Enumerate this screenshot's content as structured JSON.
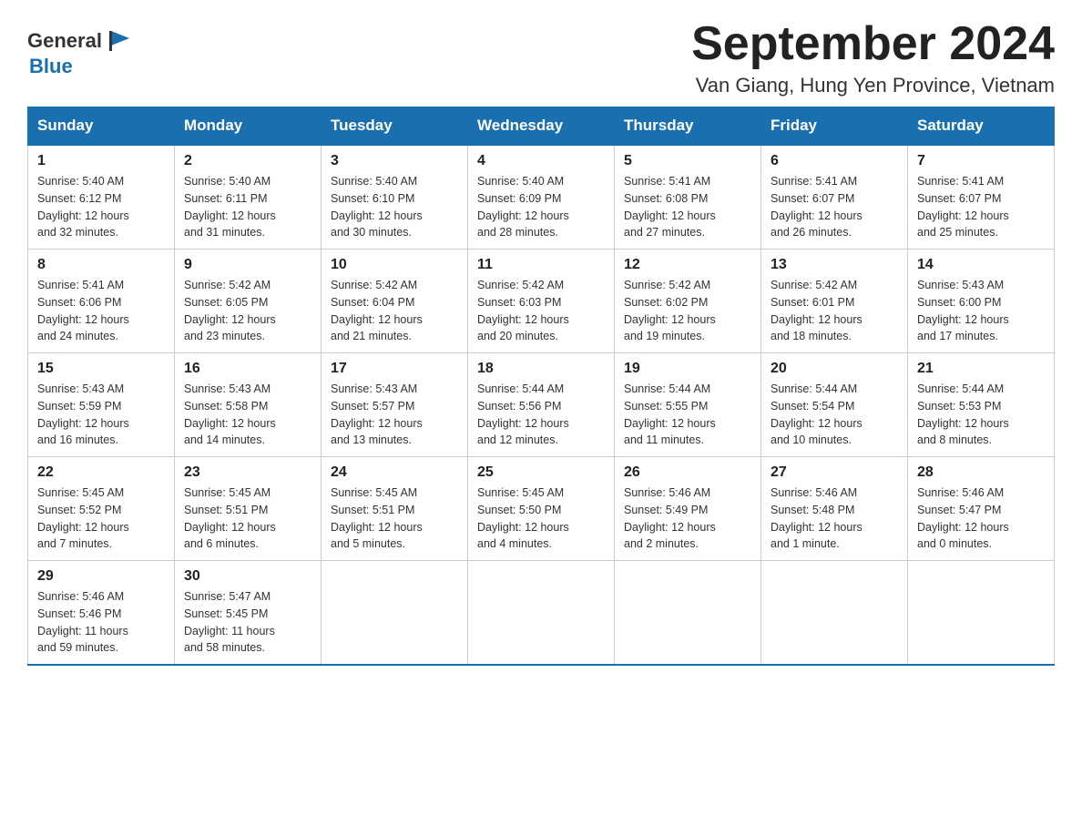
{
  "header": {
    "logo_general": "General",
    "logo_blue": "Blue",
    "month_title": "September 2024",
    "location": "Van Giang, Hung Yen Province, Vietnam"
  },
  "days_of_week": [
    "Sunday",
    "Monday",
    "Tuesday",
    "Wednesday",
    "Thursday",
    "Friday",
    "Saturday"
  ],
  "weeks": [
    [
      {
        "day": "1",
        "sunrise": "5:40 AM",
        "sunset": "6:12 PM",
        "daylight": "12 hours and 32 minutes."
      },
      {
        "day": "2",
        "sunrise": "5:40 AM",
        "sunset": "6:11 PM",
        "daylight": "12 hours and 31 minutes."
      },
      {
        "day": "3",
        "sunrise": "5:40 AM",
        "sunset": "6:10 PM",
        "daylight": "12 hours and 30 minutes."
      },
      {
        "day": "4",
        "sunrise": "5:40 AM",
        "sunset": "6:09 PM",
        "daylight": "12 hours and 28 minutes."
      },
      {
        "day": "5",
        "sunrise": "5:41 AM",
        "sunset": "6:08 PM",
        "daylight": "12 hours and 27 minutes."
      },
      {
        "day": "6",
        "sunrise": "5:41 AM",
        "sunset": "6:07 PM",
        "daylight": "12 hours and 26 minutes."
      },
      {
        "day": "7",
        "sunrise": "5:41 AM",
        "sunset": "6:07 PM",
        "daylight": "12 hours and 25 minutes."
      }
    ],
    [
      {
        "day": "8",
        "sunrise": "5:41 AM",
        "sunset": "6:06 PM",
        "daylight": "12 hours and 24 minutes."
      },
      {
        "day": "9",
        "sunrise": "5:42 AM",
        "sunset": "6:05 PM",
        "daylight": "12 hours and 23 minutes."
      },
      {
        "day": "10",
        "sunrise": "5:42 AM",
        "sunset": "6:04 PM",
        "daylight": "12 hours and 21 minutes."
      },
      {
        "day": "11",
        "sunrise": "5:42 AM",
        "sunset": "6:03 PM",
        "daylight": "12 hours and 20 minutes."
      },
      {
        "day": "12",
        "sunrise": "5:42 AM",
        "sunset": "6:02 PM",
        "daylight": "12 hours and 19 minutes."
      },
      {
        "day": "13",
        "sunrise": "5:42 AM",
        "sunset": "6:01 PM",
        "daylight": "12 hours and 18 minutes."
      },
      {
        "day": "14",
        "sunrise": "5:43 AM",
        "sunset": "6:00 PM",
        "daylight": "12 hours and 17 minutes."
      }
    ],
    [
      {
        "day": "15",
        "sunrise": "5:43 AM",
        "sunset": "5:59 PM",
        "daylight": "12 hours and 16 minutes."
      },
      {
        "day": "16",
        "sunrise": "5:43 AM",
        "sunset": "5:58 PM",
        "daylight": "12 hours and 14 minutes."
      },
      {
        "day": "17",
        "sunrise": "5:43 AM",
        "sunset": "5:57 PM",
        "daylight": "12 hours and 13 minutes."
      },
      {
        "day": "18",
        "sunrise": "5:44 AM",
        "sunset": "5:56 PM",
        "daylight": "12 hours and 12 minutes."
      },
      {
        "day": "19",
        "sunrise": "5:44 AM",
        "sunset": "5:55 PM",
        "daylight": "12 hours and 11 minutes."
      },
      {
        "day": "20",
        "sunrise": "5:44 AM",
        "sunset": "5:54 PM",
        "daylight": "12 hours and 10 minutes."
      },
      {
        "day": "21",
        "sunrise": "5:44 AM",
        "sunset": "5:53 PM",
        "daylight": "12 hours and 8 minutes."
      }
    ],
    [
      {
        "day": "22",
        "sunrise": "5:45 AM",
        "sunset": "5:52 PM",
        "daylight": "12 hours and 7 minutes."
      },
      {
        "day": "23",
        "sunrise": "5:45 AM",
        "sunset": "5:51 PM",
        "daylight": "12 hours and 6 minutes."
      },
      {
        "day": "24",
        "sunrise": "5:45 AM",
        "sunset": "5:51 PM",
        "daylight": "12 hours and 5 minutes."
      },
      {
        "day": "25",
        "sunrise": "5:45 AM",
        "sunset": "5:50 PM",
        "daylight": "12 hours and 4 minutes."
      },
      {
        "day": "26",
        "sunrise": "5:46 AM",
        "sunset": "5:49 PM",
        "daylight": "12 hours and 2 minutes."
      },
      {
        "day": "27",
        "sunrise": "5:46 AM",
        "sunset": "5:48 PM",
        "daylight": "12 hours and 1 minute."
      },
      {
        "day": "28",
        "sunrise": "5:46 AM",
        "sunset": "5:47 PM",
        "daylight": "12 hours and 0 minutes."
      }
    ],
    [
      {
        "day": "29",
        "sunrise": "5:46 AM",
        "sunset": "5:46 PM",
        "daylight": "11 hours and 59 minutes."
      },
      {
        "day": "30",
        "sunrise": "5:47 AM",
        "sunset": "5:45 PM",
        "daylight": "11 hours and 58 minutes."
      },
      null,
      null,
      null,
      null,
      null
    ]
  ],
  "labels": {
    "sunrise": "Sunrise:",
    "sunset": "Sunset:",
    "daylight": "Daylight:"
  }
}
